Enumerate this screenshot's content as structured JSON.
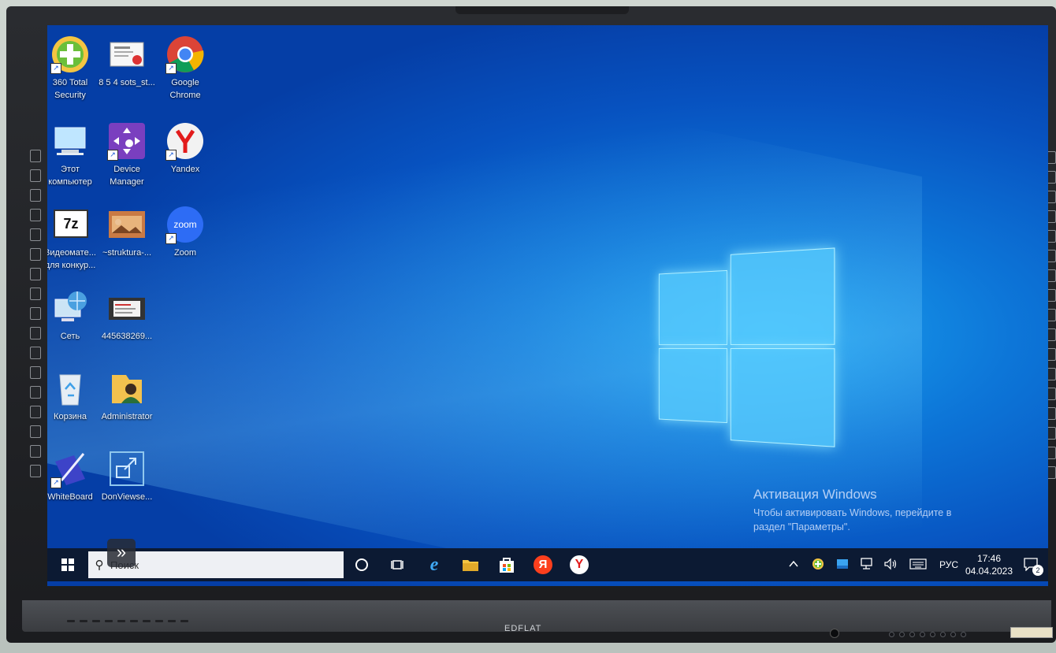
{
  "desktop": {
    "icons": [
      {
        "label": "360 Total\nSecurity",
        "icon": "360-total-security-icon"
      },
      {
        "label": "8 5 4 sots_st...",
        "icon": "document-icon"
      },
      {
        "label": "Google\nChrome",
        "icon": "chrome-icon"
      },
      {
        "label": "Этот\nкомпьютер",
        "icon": "this-pc-icon"
      },
      {
        "label": "Device\nManager",
        "icon": "device-manager-icon"
      },
      {
        "label": "Yandex",
        "icon": "yandex-browser-icon"
      },
      {
        "label": "Видеоматe...\nдля конкур...",
        "icon": "7zip-icon"
      },
      {
        "label": "~struktura-...",
        "icon": "image-icon"
      },
      {
        "label": "Zoom",
        "icon": "zoom-icon"
      },
      {
        "label": "Сеть",
        "icon": "network-icon"
      },
      {
        "label": "445638269...",
        "icon": "video-file-icon"
      },
      {
        "label": "Корзина",
        "icon": "recycle-bin-icon"
      },
      {
        "label": "Administrator",
        "icon": "user-folder-icon"
      },
      {
        "label": "WhiteBoard",
        "icon": "whiteboard-icon"
      },
      {
        "label": "DonViewse...",
        "icon": "screen-share-icon"
      }
    ],
    "zoom_text": "zoom",
    "sevenzip_text": "7z"
  },
  "activation": {
    "title": "Активация Windows",
    "line1": "Чтобы активировать Windows, перейдите в",
    "line2": "раздел \"Параметры\"."
  },
  "taskbar": {
    "search_placeholder": "Поиск",
    "pinned": [
      "cortana-icon",
      "task-view-icon",
      "internet-explorer-icon",
      "file-explorer-icon",
      "store-icon",
      "yandex-icon",
      "yandex-browser-icon"
    ],
    "yandex_letter": "Я",
    "yandex_browser_letter": "Y",
    "ie_letter": "e",
    "tray": {
      "language": "РУС",
      "time": "17:46",
      "date": "04.04.2023",
      "notifications": "2"
    }
  },
  "monitor": {
    "brand": "EDFLAT"
  },
  "colors": {
    "taskbar": "#0c1a33",
    "wallpaper": "#0d76d8",
    "accent": "#5acdff"
  }
}
